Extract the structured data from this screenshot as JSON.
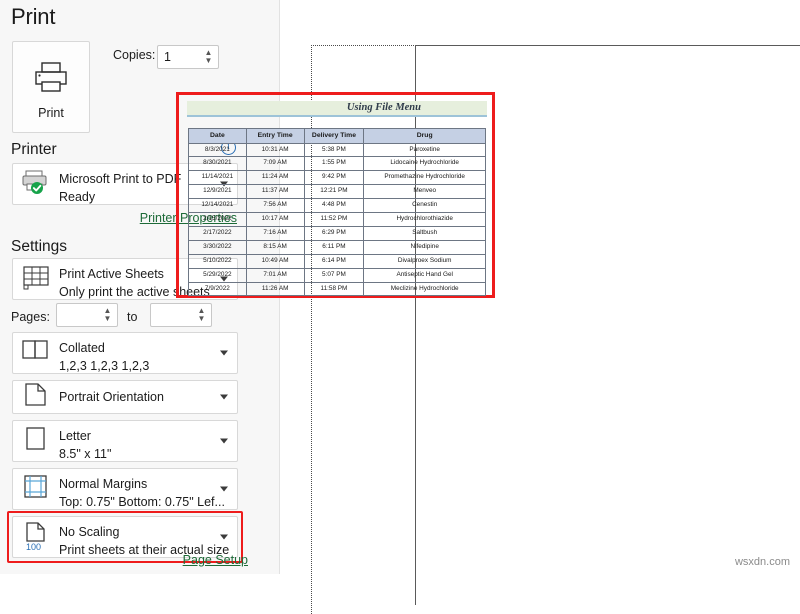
{
  "header": {
    "title": "Print"
  },
  "print_button": {
    "label": "Print",
    "icon": "printer-icon"
  },
  "copies": {
    "label": "Copies:",
    "value": "1"
  },
  "printer_section": {
    "heading": "Printer",
    "info_icon": "info-icon",
    "name": "Microsoft Print to PDF",
    "status": "Ready",
    "properties_link": "Printer Properties"
  },
  "settings_section": {
    "heading": "Settings",
    "page_setup_link": "Page Setup",
    "pages": {
      "label": "Pages:",
      "from": "",
      "to_label": "to",
      "to": ""
    },
    "options": [
      {
        "icon": "sheets-grid-icon",
        "title": "Print Active Sheets",
        "subtitle": "Only print the active sheets"
      },
      {
        "icon": "collated-icon",
        "title": "Collated",
        "subtitle": "1,2,3   1,2,3   1,2,3"
      },
      {
        "icon": "portrait-page-icon",
        "title": "Portrait Orientation",
        "subtitle": ""
      },
      {
        "icon": "paper-size-icon",
        "title": "Letter",
        "subtitle": "8.5\" x 11\""
      },
      {
        "icon": "margins-icon",
        "title": "Normal Margins",
        "subtitle": "Top: 0.75\" Bottom: 0.75\" Lef..."
      },
      {
        "icon": "scaling-icon",
        "title": "No Scaling",
        "subtitle": "Print sheets at their actual size",
        "badge": "100",
        "highlighted": true
      }
    ]
  },
  "preview": {
    "sheet_title": "Using File Menu",
    "table": {
      "columns": [
        "Date",
        "Entry Time",
        "Delivery Time",
        "Drug"
      ],
      "rows": [
        [
          "8/3/2021",
          "10:31 AM",
          "5:38 PM",
          "Paroxetine"
        ],
        [
          "8/30/2021",
          "7:09 AM",
          "1:55 PM",
          "Lidocaine Hydrochloride"
        ],
        [
          "11/14/2021",
          "11:24 AM",
          "9:42 PM",
          "Promethazine Hydrochloride"
        ],
        [
          "12/9/2021",
          "11:37 AM",
          "12:21 PM",
          "Menveo"
        ],
        [
          "12/14/2021",
          "7:56 AM",
          "4:48 PM",
          "Cenestin"
        ],
        [
          "2/15/2022",
          "10:17 AM",
          "11:52 PM",
          "Hydrochlorothiazide"
        ],
        [
          "2/17/2022",
          "7:16 AM",
          "6:29 PM",
          "Saltbush"
        ],
        [
          "3/30/2022",
          "8:15 AM",
          "6:11 PM",
          "Nifedipine"
        ],
        [
          "5/10/2022",
          "10:49 AM",
          "6:14 PM",
          "Divalproex Sodium"
        ],
        [
          "5/29/2022",
          "7:01 AM",
          "5:07 PM",
          "Antiseptic Hand Gel"
        ],
        [
          "7/9/2022",
          "11:26 AM",
          "11:58 PM",
          "Meclizine Hydrochloride"
        ]
      ]
    }
  },
  "watermark": {
    "text": "wsxdn.com"
  },
  "colors": {
    "accent_green": "#1d6b38",
    "highlight_red": "#ee1c1c",
    "table_header": "#c5d0e4",
    "title_band": "#e6efdd"
  }
}
